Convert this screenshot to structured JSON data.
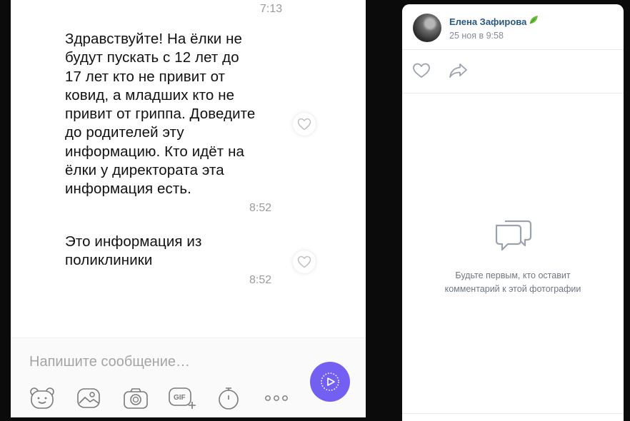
{
  "chat": {
    "top_time": "7:13",
    "messages": [
      {
        "lines": [
          "Здравствуйте! На ёлки не",
          "будут пускать с 12 лет до",
          "17 лет кто не привит от",
          "ковид, а младших кто не",
          "привит от гриппа. Доведите",
          "до родителей эту",
          "информацию. Кто идёт на",
          "ёлки у директората эта",
          "информация есть."
        ],
        "time": "8:52"
      },
      {
        "lines": [
          "Это информация из",
          "поликлиники"
        ],
        "time": "8:52"
      }
    ],
    "composer": {
      "placeholder": "Напишите сообщение…",
      "tools": [
        "sticker-icon",
        "gallery-icon",
        "camera-icon",
        "gif-icon",
        "timer-icon",
        "more-icon"
      ],
      "gif_label": "GIF",
      "send_icon": "send-video-icon",
      "accent": "#7360f2"
    }
  },
  "post": {
    "author": "Елена Зафирова",
    "author_badge": "leaf-icon",
    "date": "25 ноя в 9:58",
    "actions": [
      "like-icon",
      "share-icon"
    ],
    "empty_comments_icon": "comments-icon",
    "empty_comments_lines": [
      "Будьте первым, кто оставит",
      "комментарий к этой фотографии"
    ],
    "link_color": "#2a5885"
  }
}
